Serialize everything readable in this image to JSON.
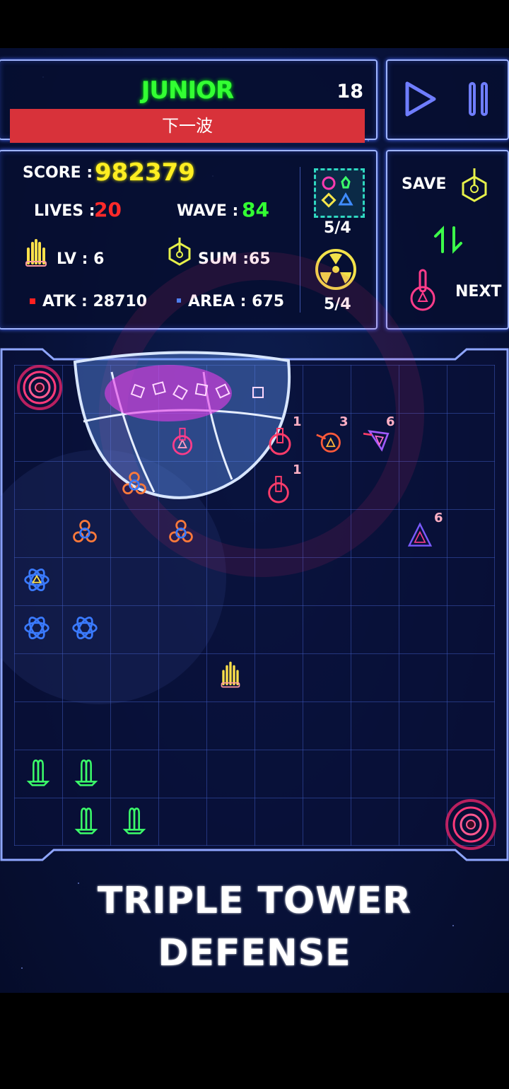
{
  "header": {
    "rank": "JUNIOR",
    "level": "18",
    "next_wave_label": "下一波"
  },
  "controls": {
    "play_icon": "play-icon",
    "pause_icon": "pause-icon"
  },
  "stats": {
    "score_label": "SCORE :",
    "score_value": "982379",
    "lives_label": "LIVES :",
    "lives_value": "20",
    "wave_label": "WAVE :",
    "wave_value": "84",
    "lv_label": "LV : 6",
    "sum_label": "SUM :65",
    "atk_label": "ATK : 28710",
    "area_label": "AREA : 675",
    "slot1_count": "5/4",
    "slot2_count": "5/4"
  },
  "side_panel": {
    "save_label": "SAVE",
    "next_label": "NEXT"
  },
  "enemy_tags": [
    "1",
    "3",
    "6",
    "1",
    "6"
  ],
  "footer": {
    "line1": "TRIPLE TOWER",
    "line2": "DEFENSE"
  },
  "colors": {
    "accent_green": "#33ff33",
    "score_yellow": "#ffee22",
    "lives_red": "#ff2a2a",
    "wave_green": "#33ff33",
    "next_wave_red": "#d8323a",
    "panel_border": "#9fb4ff"
  }
}
